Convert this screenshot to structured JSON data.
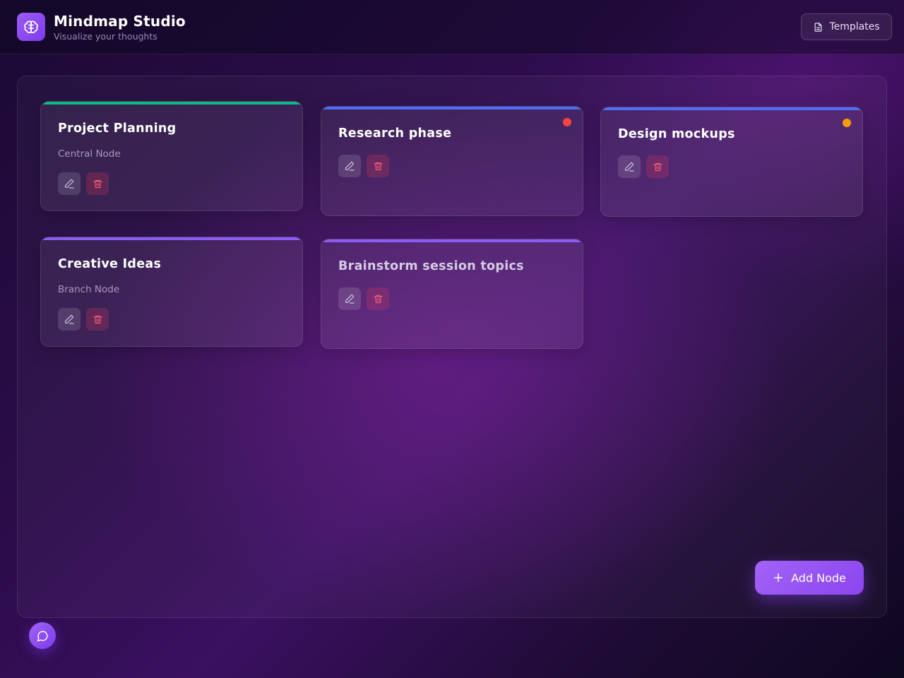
{
  "header": {
    "title": "Mindmap Studio",
    "subtitle": "Visualize your thoughts",
    "logo_icon": "brain-icon",
    "templates_label": "Templates",
    "templates_icon": "document-icon"
  },
  "nodes": [
    {
      "title": "Project Planning",
      "subtitle": "Central Node",
      "accent": "#10b981",
      "status_dot": null
    },
    {
      "title": "Research phase",
      "subtitle": "",
      "accent": "#4f6ef7",
      "status_dot": "#ef4444"
    },
    {
      "title": "Design mockups",
      "subtitle": "",
      "accent": "#4f6ef7",
      "status_dot": "#f59e0b"
    },
    {
      "title": "Creative Ideas",
      "subtitle": "Branch Node",
      "accent": "#8b5cf6",
      "status_dot": null
    },
    {
      "title": "Brainstorm session topics",
      "subtitle": "",
      "accent": "#8b5cf6",
      "status_dot": null
    }
  ],
  "node_actions": {
    "edit_icon": "pencil-icon",
    "delete_icon": "trash-icon"
  },
  "add_node": {
    "label": "Add Node",
    "icon": "plus-icon"
  },
  "chat": {
    "icon": "chat-bubble-icon"
  },
  "colors": {
    "brand": "#8b5cf6",
    "delete": "#ef4444"
  }
}
